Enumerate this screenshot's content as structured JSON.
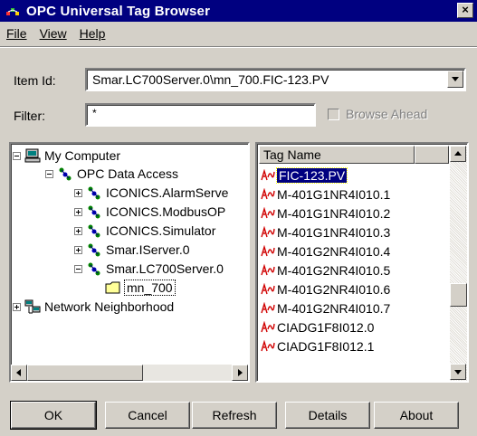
{
  "window": {
    "title": "OPC Universal Tag Browser",
    "close_glyph": "×",
    "title_icon": "opc-app-icon"
  },
  "menu": {
    "items": [
      {
        "label": "File"
      },
      {
        "label": "View"
      },
      {
        "label": "Help"
      }
    ]
  },
  "item_id": {
    "label": "Item Id:",
    "value": "Smar.LC700Server.0\\mn_700.FIC-123.PV"
  },
  "filter": {
    "label": "Filter:",
    "value": "*"
  },
  "browse_ahead": {
    "label": "Browse Ahead",
    "checked": false,
    "enabled": false
  },
  "tree": {
    "nodes": [
      {
        "label": "My Computer",
        "icon": "computer-icon",
        "expander": "minus"
      },
      {
        "label": "OPC Data Access",
        "icon": "opc-node-icon",
        "expander": "minus"
      },
      {
        "label": "ICONICS.AlarmServe",
        "icon": "opc-node-icon",
        "expander": "plus"
      },
      {
        "label": "ICONICS.ModbusOP",
        "icon": "opc-node-icon",
        "expander": "plus"
      },
      {
        "label": "ICONICS.Simulator",
        "icon": "opc-node-icon",
        "expander": "plus"
      },
      {
        "label": "Smar.IServer.0",
        "icon": "opc-node-icon",
        "expander": "plus"
      },
      {
        "label": "Smar.LC700Server.0",
        "icon": "opc-node-icon",
        "expander": "minus"
      },
      {
        "label": "mn_700",
        "icon": "folder-icon",
        "expander": "none"
      },
      {
        "label": "Network Neighborhood",
        "icon": "network-icon",
        "expander": "plus"
      }
    ]
  },
  "tag_list": {
    "column_header": "Tag Name",
    "rows": [
      {
        "label": "FIC-123.PV",
        "selected": true
      },
      {
        "label": "M-401G1NR4I010.1",
        "selected": false
      },
      {
        "label": "M-401G1NR4I010.2",
        "selected": false
      },
      {
        "label": "M-401G1NR4I010.3",
        "selected": false
      },
      {
        "label": "M-401G2NR4I010.4",
        "selected": false
      },
      {
        "label": "M-401G2NR4I010.5",
        "selected": false
      },
      {
        "label": "M-401G2NR4I010.6",
        "selected": false
      },
      {
        "label": "M-401G2NR4I010.7",
        "selected": false
      },
      {
        "label": "CIADG1F8I012.0",
        "selected": false
      },
      {
        "label": "CIADG1F8I012.1",
        "selected": false
      }
    ]
  },
  "buttons": {
    "ok": "OK",
    "cancel": "Cancel",
    "refresh": "Refresh",
    "details": "Details",
    "about": "About"
  },
  "colors": {
    "title_bar": "#000080",
    "face": "#d4d0c8",
    "selection": "#000080"
  }
}
